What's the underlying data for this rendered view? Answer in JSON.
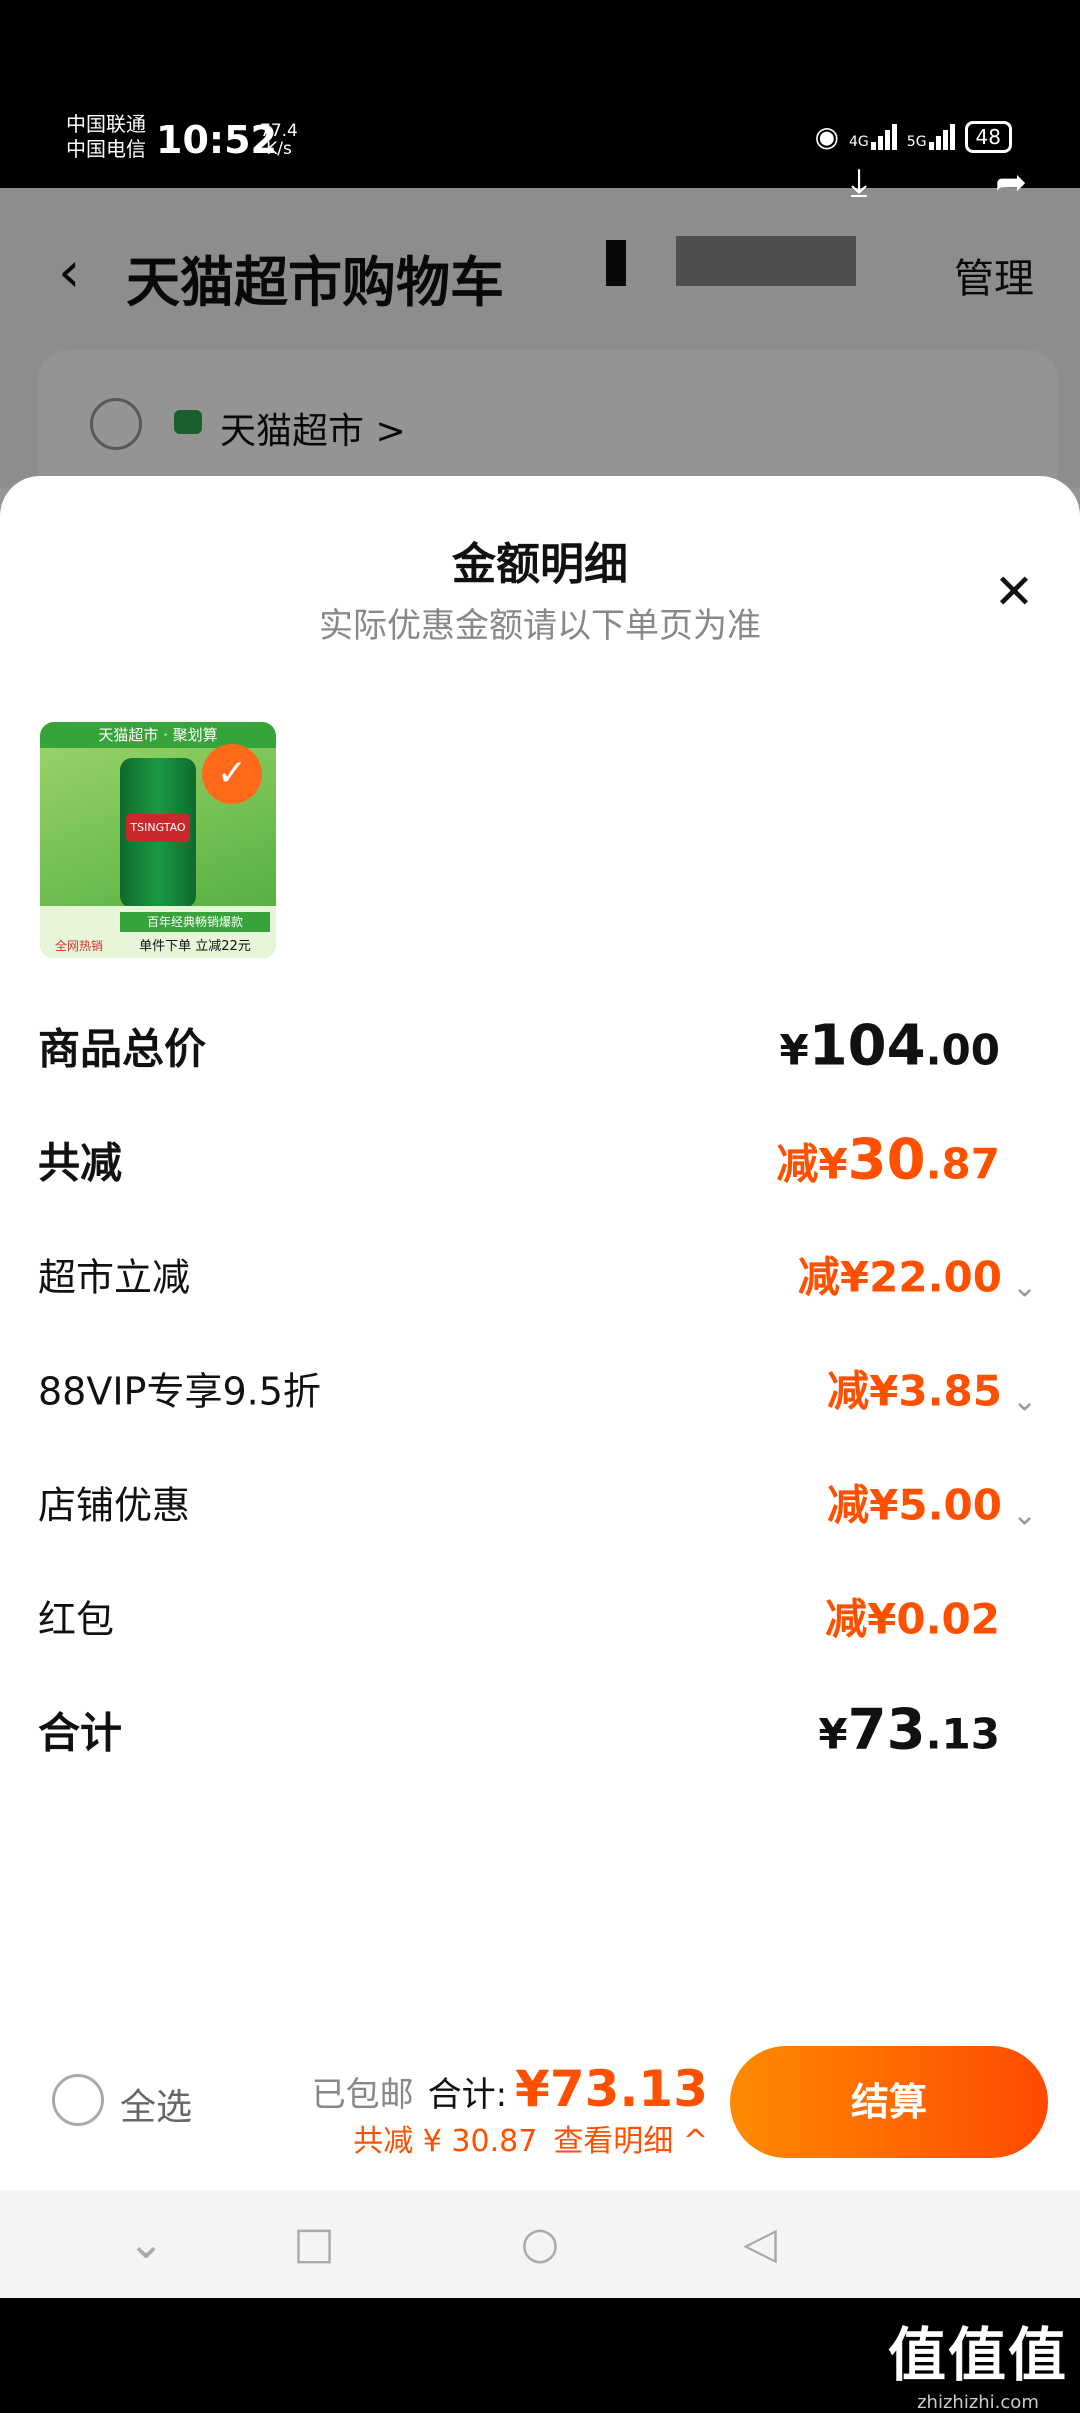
{
  "status_bar": {
    "carrier1": "中国联通",
    "carrier2": "中国电信",
    "time": "10:52",
    "net_speed_value": "77.4",
    "net_speed_unit": "K/s",
    "signal1": "4G",
    "signal2": "5G",
    "battery": "48"
  },
  "background_page": {
    "back_icon": "chevron-left-icon",
    "title": "天猫超市购物车",
    "manage_label": "管理",
    "store_name": "天猫超市 >"
  },
  "sheet": {
    "title": "金额明细",
    "subtitle": "实际优惠金额请以下单页为准",
    "close_icon": "close-icon"
  },
  "product": {
    "banner": "天猫超市 · 聚划算",
    "can_label": "TSINGTAO",
    "footer_line1": "百年经典畅销爆款",
    "footer_line2": "单件下单 立减22元",
    "tag": "全网热销"
  },
  "breakdown": {
    "subtotal_label": "商品总价",
    "subtotal_currency": "¥",
    "subtotal_int": "104",
    "subtotal_dec": ".00",
    "discount_label": "共减",
    "discount_prefix": "减",
    "discount_currency": "¥",
    "discount_int": "30",
    "discount_dec": ".87",
    "items": [
      {
        "label": "超市立减",
        "prefix": "减",
        "currency": "¥",
        "value": "22.00",
        "has_arrow": true
      },
      {
        "label": "88VIP专享9.5折",
        "prefix": "减",
        "currency": "¥",
        "value": "3.85",
        "has_arrow": true
      },
      {
        "label": "店铺优惠",
        "prefix": "减",
        "currency": "¥",
        "value": "5.00",
        "has_arrow": true
      },
      {
        "label": "红包",
        "prefix": "减",
        "currency": "¥",
        "value": "0.02",
        "has_arrow": false
      }
    ],
    "total_label": "合计",
    "total_currency": "¥",
    "total_int": "73",
    "total_dec": ".13"
  },
  "checkout": {
    "select_all": "全选",
    "free_shipping": "已包邮",
    "total_label": "合计:",
    "total_value": "¥73.13",
    "saved": "共减 ¥ 30.87",
    "detail_link": "查看明细 ^",
    "pay_label": "结算"
  },
  "watermark": {
    "big": "值值值",
    "small": "zhizhizhi.com"
  },
  "colors": {
    "accent": "#ff5000",
    "button_start": "#ff8a00",
    "button_end": "#ff4a00"
  }
}
